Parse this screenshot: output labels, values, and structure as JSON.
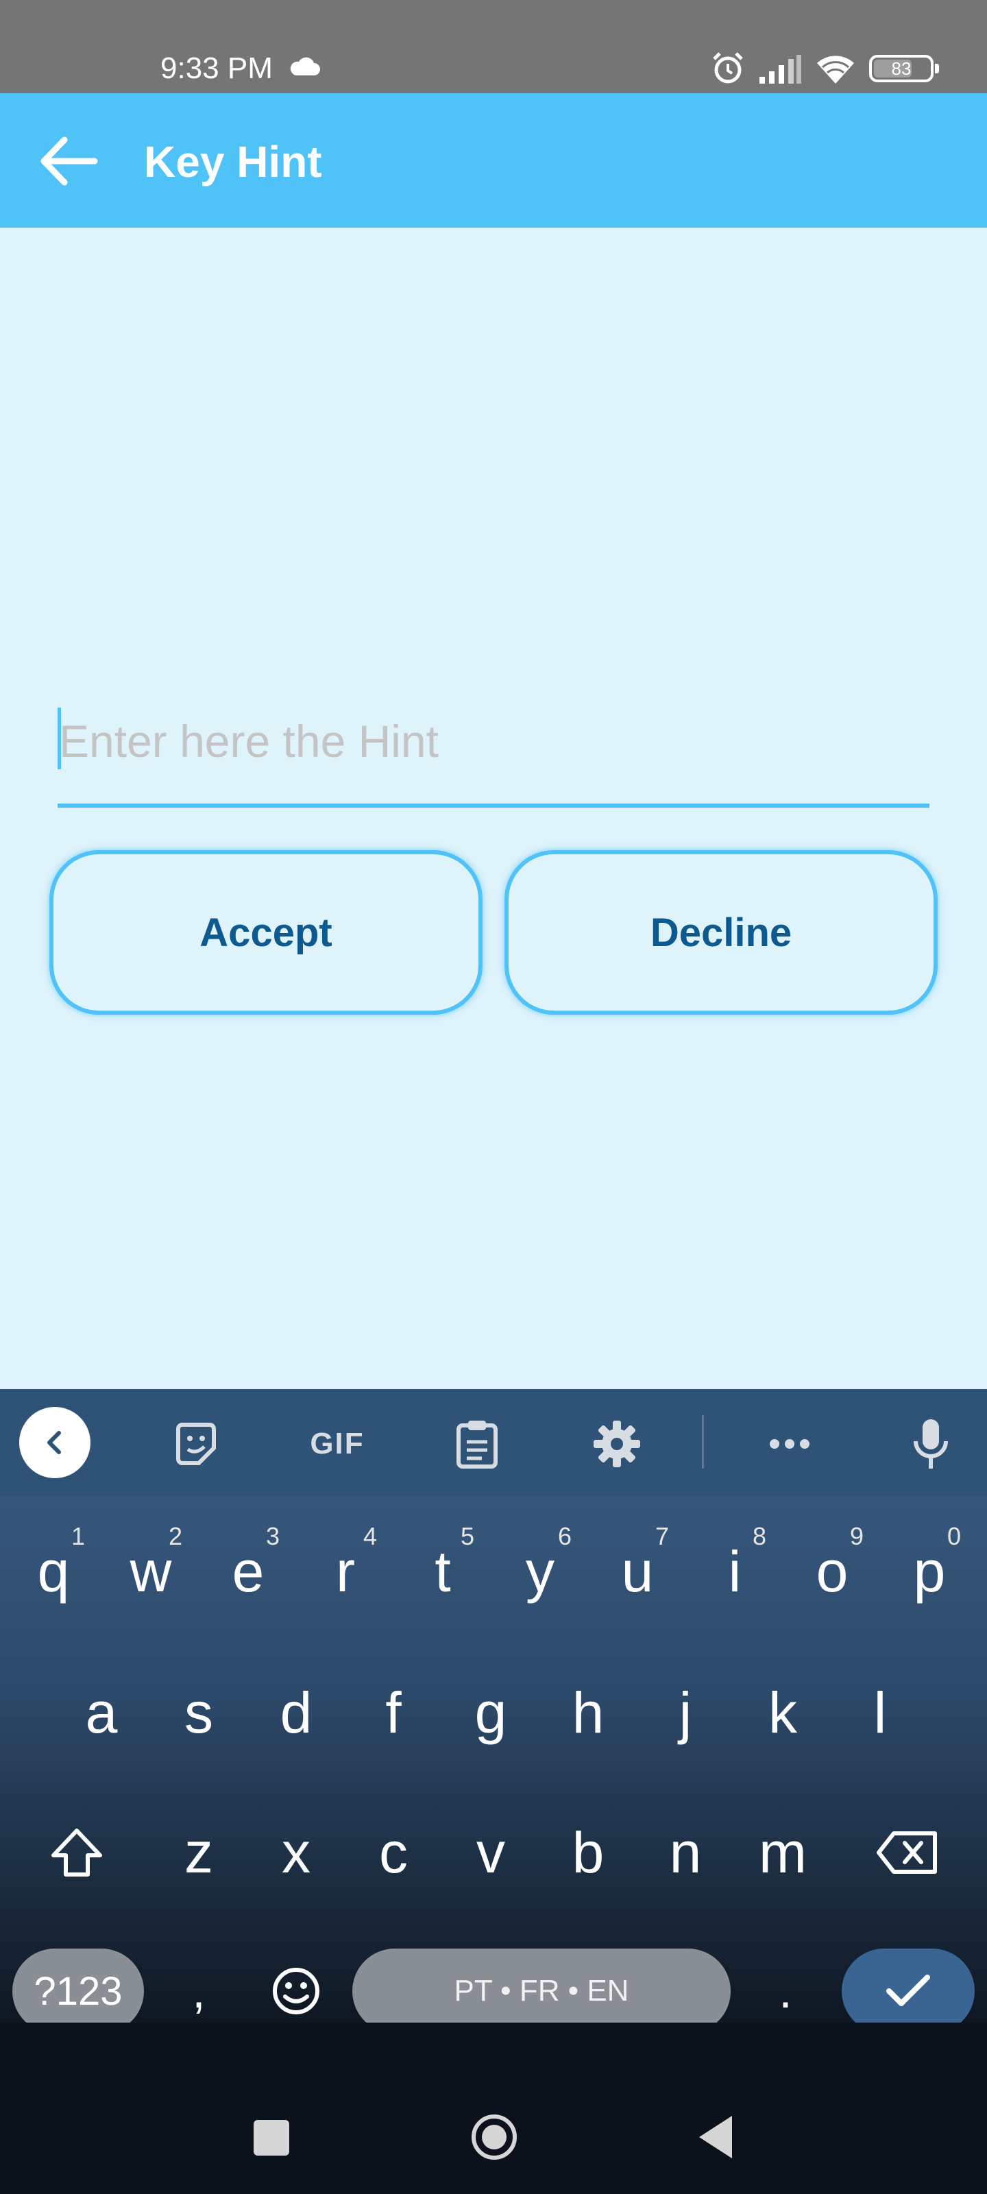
{
  "status_bar": {
    "time": "9:33 PM",
    "battery": "83",
    "icons": [
      "cloud-icon",
      "alarm-icon",
      "signal-icon",
      "wifi-icon",
      "battery-icon"
    ]
  },
  "app_bar": {
    "title": "Key Hint",
    "back_icon": "arrow-left-icon",
    "background": "#4fc3f7"
  },
  "hint_input": {
    "placeholder": "Enter here the Hint",
    "value": ""
  },
  "buttons": {
    "accept": "Accept",
    "decline": "Decline"
  },
  "keyboard": {
    "toolbar_icons": [
      "chevron-left-icon",
      "sticker-icon",
      "gif-icon",
      "clipboard-icon",
      "gear-icon",
      "more-icon",
      "microphone-icon"
    ],
    "gif_label": "GIF",
    "row1": [
      {
        "key": "q",
        "hint": "1"
      },
      {
        "key": "w",
        "hint": "2"
      },
      {
        "key": "e",
        "hint": "3"
      },
      {
        "key": "r",
        "hint": "4"
      },
      {
        "key": "t",
        "hint": "5"
      },
      {
        "key": "y",
        "hint": "6"
      },
      {
        "key": "u",
        "hint": "7"
      },
      {
        "key": "i",
        "hint": "8"
      },
      {
        "key": "o",
        "hint": "9"
      },
      {
        "key": "p",
        "hint": "0"
      }
    ],
    "row2": [
      "a",
      "s",
      "d",
      "f",
      "g",
      "h",
      "j",
      "k",
      "l"
    ],
    "row3": [
      "z",
      "x",
      "c",
      "v",
      "b",
      "n",
      "m"
    ],
    "symbols_key": "?123",
    "comma_key": ",",
    "space_label": "PT • FR • EN",
    "period_key": ".",
    "accent": "#3a6492"
  },
  "nav_bar": {
    "icons": [
      "recents-icon",
      "home-icon",
      "back-icon"
    ]
  }
}
